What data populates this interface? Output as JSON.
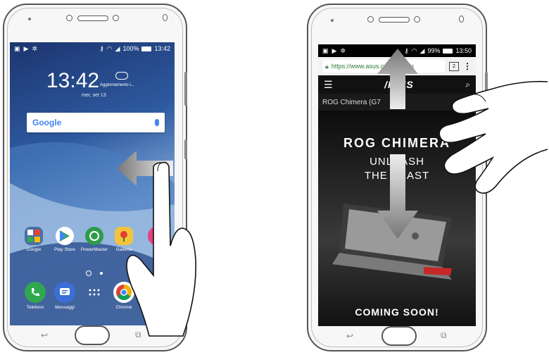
{
  "left_phone": {
    "status": {
      "battery": "100%",
      "time": "13:42"
    },
    "clock": "13:42",
    "weather": "Aggiornamento i...",
    "date": "mer, set 13",
    "search": {
      "logo": "Google"
    },
    "apps_row1": [
      {
        "label": "Google",
        "color": "#4a6fa5"
      },
      {
        "label": "Play Store",
        "color": "#ffffff"
      },
      {
        "label": "PowerMaster",
        "color": "#2e9b4a"
      },
      {
        "label": "Galleria",
        "color": "#f3c33a"
      }
    ],
    "dock": [
      {
        "label": "Telefono",
        "color": "#2fa84f"
      },
      {
        "label": "Messaggi",
        "color": "#3b6fd8"
      },
      {
        "label": "",
        "color": "#e9eef5"
      },
      {
        "label": "Chrome",
        "color": "#ffffff"
      }
    ]
  },
  "right_phone": {
    "status": {
      "battery": "99%",
      "time": "13:50"
    },
    "url": "https://www.asus.com/Laptop",
    "tabs": "2",
    "brand": "/ISUS",
    "breadcrumb": "ROG Chimera (G7",
    "hero": {
      "title": "ROG CHIMERA",
      "line1": "UNLEASH",
      "line2": "THE BEAST",
      "footer": "COMING SOON!"
    }
  },
  "colors": {
    "wallpaper_top": "#1e3c78",
    "wallpaper_bottom": "#8fb3d9",
    "accent_green": "#2e7d32"
  }
}
